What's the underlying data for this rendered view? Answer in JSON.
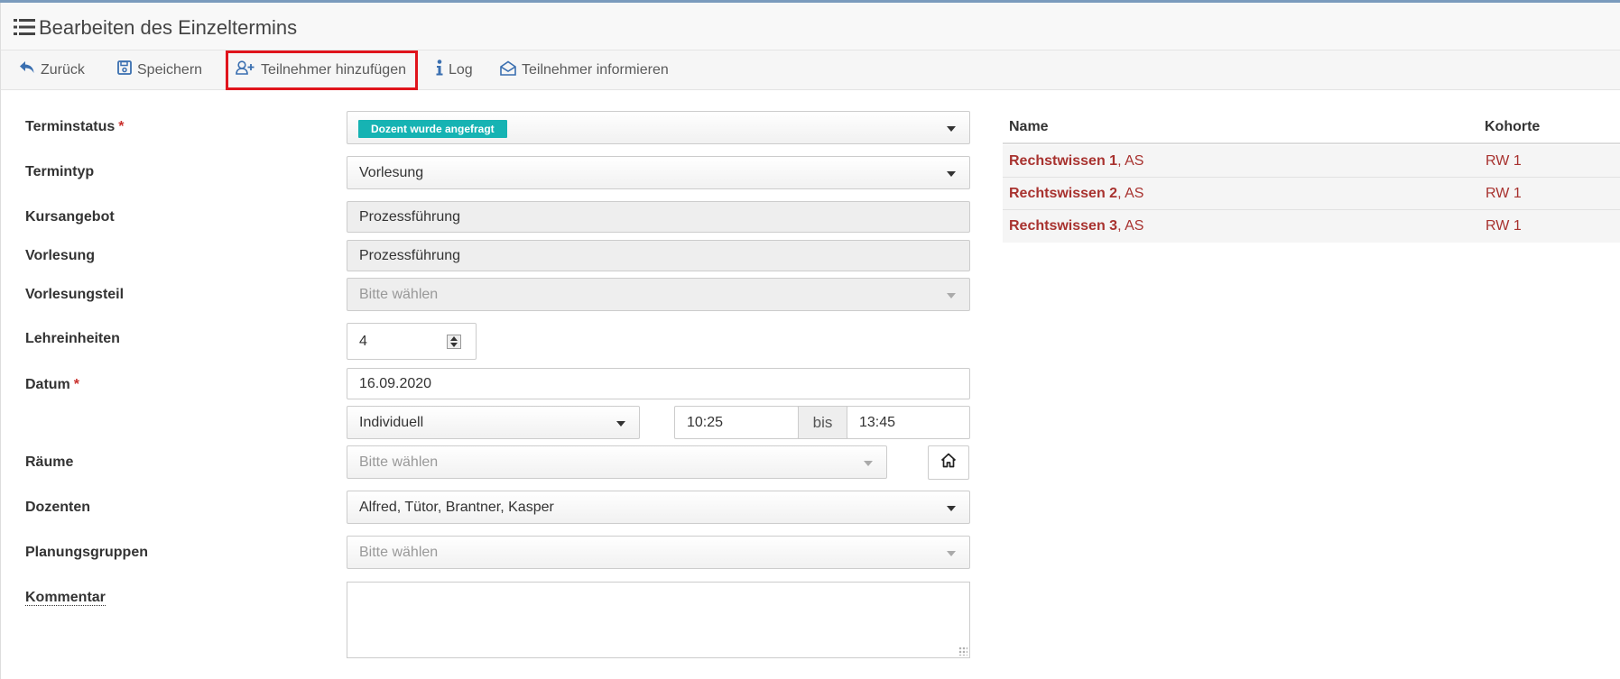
{
  "header": {
    "title": "Bearbeiten des Einzeltermins",
    "icon": "list-icon"
  },
  "toolbar": {
    "back": "Zurück",
    "save": "Speichern",
    "add_participant": "Teilnehmer hinzufügen",
    "log": "Log",
    "inform": "Teilnehmer informieren"
  },
  "form": {
    "status": {
      "label": "Terminstatus",
      "required": "*",
      "value": "Dozent wurde angefragt",
      "badge_color": "#16b3b3"
    },
    "type": {
      "label": "Termintyp",
      "value": "Vorlesung"
    },
    "course": {
      "label": "Kursangebot",
      "value": "Prozessführung"
    },
    "lecture": {
      "label": "Vorlesung",
      "value": "Prozessführung"
    },
    "lecture_part": {
      "label": "Vorlesungsteil",
      "placeholder": "Bitte wählen"
    },
    "units": {
      "label": "Lehreinheiten",
      "value": "4"
    },
    "date": {
      "label": "Datum",
      "required": "*",
      "value": "16.09.2020"
    },
    "time_mode": {
      "value": "Individuell"
    },
    "time_from": "10:25",
    "time_sep": "bis",
    "time_to": "13:45",
    "rooms": {
      "label": "Räume",
      "placeholder": "Bitte wählen"
    },
    "lecturers": {
      "label": "Dozenten",
      "value": "Alfred, Tütor, Brantner, Kasper"
    },
    "planning_groups": {
      "label": "Planungsgruppen",
      "placeholder": "Bitte wählen"
    },
    "comment": {
      "label": "Kommentar"
    }
  },
  "participants": {
    "columns": [
      "Name",
      "Kohorte"
    ],
    "rows": [
      {
        "name": "Rechstwissen 1",
        "suffix": ", AS",
        "cohort": "RW 1"
      },
      {
        "name": "Rechtswissen 2",
        "suffix": ", AS",
        "cohort": "RW 1"
      },
      {
        "name": "Rechtswissen 3",
        "suffix": ", AS",
        "cohort": "RW 1"
      }
    ],
    "link_color": "#a8322f"
  }
}
